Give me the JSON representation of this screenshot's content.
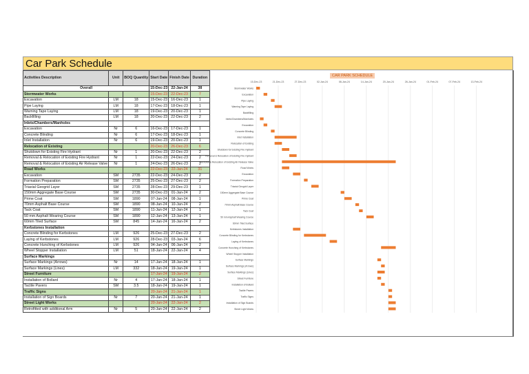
{
  "title": "Car Park Schedule",
  "headers": [
    "Activities Description",
    "Unit",
    "BOQ Quantity",
    "Start Date",
    "Finish Date",
    "Duration"
  ],
  "rows": [
    [
      "Overall",
      "",
      "",
      "15-Dec-23",
      "22-Jan-24",
      "38",
      "overall"
    ],
    [
      "Stormwater Works",
      "",
      "",
      "15-Dec-23",
      "22-Dec-23",
      "7",
      "group"
    ],
    [
      "Excavation",
      "LM",
      "18",
      "15-Dec-23",
      "16-Dec-23",
      "1",
      "item"
    ],
    [
      "Pipe Laying",
      "LM",
      "18",
      "17-Dec-23",
      "18-Dec-23",
      "1",
      "item"
    ],
    [
      "Warning Tape Laying",
      "LM",
      "18",
      "19-Dec-23",
      "20-Dec-23",
      "1",
      "item"
    ],
    [
      "Backfilling",
      "LM",
      "18",
      "20-Dec-23",
      "22-Dec-23",
      "2",
      "item"
    ],
    [
      "Inlets/Chambers/Manholes",
      "",
      "",
      "",
      "",
      "",
      "section"
    ],
    [
      "Excavation",
      "Nr",
      "6",
      "16-Dec-23",
      "17-Dec-23",
      "1",
      "item"
    ],
    [
      "Concrete Blinding",
      "Nr",
      "6",
      "17-Dec-23",
      "18-Dec-23",
      "1",
      "item"
    ],
    [
      "Inlet Installation",
      "Nr",
      "6",
      "19-Dec-23",
      "20-Dec-23",
      "1",
      "item"
    ],
    [
      "Relocation of Existing",
      "",
      "",
      "20-Dec-23",
      "26-Dec-23",
      "6",
      "group"
    ],
    [
      "Shutdown for Existing Fire Hydrant",
      "Nr",
      "1",
      "20-Dec-23",
      "22-Dec-23",
      "2",
      "item"
    ],
    [
      "Removal & Relocation of Existing Fire Hydrant",
      "Nr",
      "1",
      "22-Dec-23",
      "24-Dec-23",
      "2",
      "item"
    ],
    [
      "Removal & Relocation of Existing Air Release Valve",
      "Nr",
      "1",
      "24-Dec-23",
      "26-Dec-23",
      "2",
      "item"
    ],
    [
      "Road Works",
      "",
      "",
      "22-Dec-23",
      "22-Jan-24",
      "31",
      "group"
    ],
    [
      "Excavation",
      "SM",
      "2735",
      "22-Dec-23",
      "24-Dec-23",
      "2",
      "item"
    ],
    [
      "Formation Preparation",
      "SM",
      "2735",
      "25-Dec-23",
      "27-Dec-23",
      "2",
      "item"
    ],
    [
      "Triaxial Geogrid Layer",
      "SM",
      "2735",
      "28-Dec-23",
      "29-Dec-23",
      "1",
      "item"
    ],
    [
      "150mm Aggregate Base Course",
      "SM",
      "2735",
      "30-Dec-23",
      "01-Jan-24",
      "2",
      "item"
    ],
    [
      "Prime Coat",
      "SM",
      "1890",
      "07-Jan-24",
      "08-Jan-24",
      "1",
      "item"
    ],
    [
      "70mm Asphalt Base Course",
      "SM",
      "1890",
      "08-Jan-24",
      "10-Jan-24",
      "2",
      "item"
    ],
    [
      "Tack Coat",
      "SM",
      "1890",
      "11-Jan-24",
      "12-Jan-24",
      "1",
      "item"
    ],
    [
      "50 mm Asphalt Wearing Course",
      "SM",
      "1890",
      "12-Jan-24",
      "13-Jan-24",
      "1",
      "item"
    ],
    [
      "60mm Tiled Surface",
      "SM",
      "845",
      "14-Jan-24",
      "16-Jan-24",
      "2",
      "item"
    ],
    [
      "Kerbstones Installation",
      "",
      "",
      "",
      "",
      "",
      "section"
    ],
    [
      "Concrete Blinding for Kerbstones",
      "LM",
      "926",
      "25-Dec-23",
      "27-Dec-23",
      "2",
      "item"
    ],
    [
      "Laying of Kerbstones",
      "LM",
      "926",
      "28-Dec-23",
      "03-Jan-24",
      "6",
      "item"
    ],
    [
      "Concrete Hunching of Kerbstones",
      "LM",
      "926",
      "04-Jan-24",
      "06-Jan-24",
      "2",
      "item"
    ],
    [
      "Wheel Stopper Installation",
      "LM",
      "51",
      "18-Jan-24",
      "22-Jan-24",
      "4",
      "item"
    ],
    [
      "Surface Markings",
      "",
      "",
      "",
      "",
      "",
      "section"
    ],
    [
      "Surface Markings (Arrows)",
      "Nr",
      "14",
      "17-Jan-24",
      "18-Jan-24",
      "1",
      "item"
    ],
    [
      "Surface Markings (Lines)",
      "LM",
      "332",
      "18-Jan-24",
      "19-Jan-24",
      "1",
      "item"
    ],
    [
      "Street Furniture",
      "",
      "",
      "17-Jan-24",
      "19-Jan-24",
      "2",
      "group"
    ],
    [
      "Installation of Bollard",
      "Nr",
      "4",
      "17-Jan-24",
      "18-Jan-24",
      "1",
      "item"
    ],
    [
      "Tactile Pavers",
      "SM",
      "3.5",
      "18-Jan-24",
      "19-Jan-24",
      "1",
      "item"
    ],
    [
      "Traffic Signs",
      "",
      "",
      "20-Jan-24",
      "21-Jan-24",
      "1",
      "group"
    ],
    [
      "Installation of Sign Boards",
      "Nr",
      "7",
      "20-Jan-24",
      "21-Jan-24",
      "1",
      "item"
    ],
    [
      "Street Light Works",
      "",
      "",
      "20-Jan-24",
      "22-Jan-24",
      "2",
      "group"
    ],
    [
      "Retrofitted with additional Arm",
      "Nr",
      "5",
      "20-Jan-24",
      "22-Jan-24",
      "2",
      "item"
    ]
  ],
  "chart_data": {
    "type": "bar",
    "orientation": "horizontal-gantt",
    "title": "CAR PARK SCHEDULE",
    "bar_color": "#ed7d31",
    "x_ticks": [
      "15-Dec-23",
      "21-Dec-23",
      "27-Dec-23",
      "02-Jan-24",
      "08-Jan-24",
      "14-Jan-24",
      "20-Jan-24",
      "26-Jan-24",
      "01-Feb-24",
      "07-Feb-24",
      "13-Feb-24"
    ],
    "x_unit": "days from 15-Dec-23",
    "xlim": [
      0,
      60
    ],
    "categories": [
      "Stormwater Works",
      "Excavation",
      "Pipe Laying",
      "Warning Tape Laying",
      "Backfilling",
      "Inlets/Chambers/Manholes",
      "Excavation",
      "Concrete Blinding",
      "Inlet Installation",
      "Relocation of Existing",
      "Shutdown for Existing Fire Hydrant",
      "Removal & Relocation of Existing Fire Hydrant",
      "Removal & Relocation of Existing Air Release Valve",
      "Road Works",
      "Excavation",
      "Formation Preparation",
      "Triaxial Geogrid Layer",
      "150mm Aggregate Base Course",
      "Prime Coat",
      "70mm Asphalt Base Course",
      "Tack Coat",
      "50 mm Asphalt Wearing Course",
      "60mm Tiled Surface",
      "Kerbstones Installation",
      "Concrete Blinding for Kerbstones",
      "Laying of Kerbstones",
      "Concrete Hunching of Kerbstones",
      "Wheel Stopper Installation",
      "Surface Markings",
      "Surface Markings (Arrows)",
      "Surface Markings (Lines)",
      "Street Furniture",
      "Installation of Bollard",
      "Tactile Pavers",
      "Traffic Signs",
      "Installation of Sign Boards",
      "Street Light Works"
    ],
    "start": [
      0,
      2,
      4,
      5,
      null,
      1,
      2,
      4,
      5,
      5,
      7,
      9,
      7,
      7,
      10,
      13,
      15,
      23,
      24,
      27,
      28,
      30,
      null,
      10,
      13,
      20,
      34,
      null,
      33,
      34,
      33,
      33,
      34,
      36,
      36,
      36,
      36
    ],
    "duration": [
      1,
      1,
      1,
      2,
      null,
      1,
      1,
      1,
      6,
      2,
      2,
      2,
      31,
      2,
      2,
      1,
      2,
      1,
      2,
      1,
      1,
      2,
      null,
      2,
      6,
      2,
      4,
      null,
      1,
      1,
      2,
      1,
      1,
      1,
      1,
      2,
      2
    ]
  }
}
